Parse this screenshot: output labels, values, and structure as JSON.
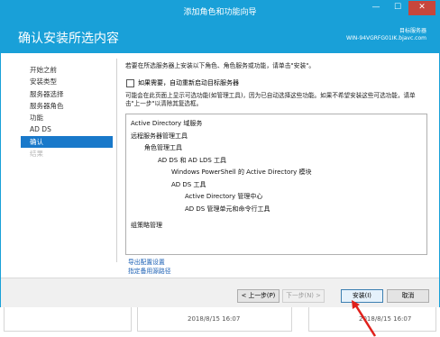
{
  "window": {
    "title": "添加角色和功能向导",
    "controls": {
      "minimize": "—",
      "maximize": "☐",
      "close": "✕"
    }
  },
  "header": {
    "title": "确认安装所选内容",
    "destination_label": "目标服务器",
    "destination_server": "WIN-94VGRFG01IK.bjavc.com"
  },
  "nav": {
    "items": [
      {
        "label": "开始之前",
        "state": "normal"
      },
      {
        "label": "安装类型",
        "state": "normal"
      },
      {
        "label": "服务器选择",
        "state": "normal"
      },
      {
        "label": "服务器角色",
        "state": "normal"
      },
      {
        "label": "功能",
        "state": "normal"
      },
      {
        "label": "AD DS",
        "state": "normal"
      },
      {
        "label": "确认",
        "state": "active"
      },
      {
        "label": "结果",
        "state": "disabled"
      }
    ]
  },
  "main": {
    "intro": "若要在所选服务器上安装以下角色、角色服务或功能，请单击\"安装\"。",
    "restart_checkbox": {
      "label": "如果需要，自动重新启动目标服务器",
      "checked": false
    },
    "note": "可能会在此页面上显示可选功能(如管理工具)，因为已自动选择这些功能。如果不希望安装这些可选功能，请单击\"上一步\"以清除其复选框。",
    "features": [
      "Active Directory 域服务",
      "远程服务器管理工具",
      "角色管理工具",
      "AD DS 和 AD LDS 工具",
      "Windows PowerShell 的 Active Directory 模块",
      "AD DS 工具",
      "Active Directory 管理中心",
      "AD DS 管理单元和命令行工具",
      "组策略管理"
    ],
    "export_link": "导出配置设置",
    "alt_source_link": "指定备用源路径"
  },
  "footer": {
    "prev": "< 上一步(P)",
    "next": "下一步(N) >",
    "install": "安装(I)",
    "cancel": "取消"
  },
  "background": {
    "timestamp_1": "2018/8/15 16:07",
    "timestamp_2": "2018/8/15 16:07"
  },
  "colors": {
    "title_bar": "#19a0d8",
    "nav_active": "#1979ca",
    "link": "#1a5fb4",
    "close_button": "#c7463c",
    "annotation_arrow": "#e0201b"
  }
}
